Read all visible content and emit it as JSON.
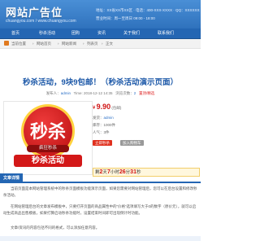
{
  "header": {
    "site_title": "网站广告位",
    "site_url": "chuangyou.com / www.chuangyou.com",
    "info_line1": "地址：XX省XX市XX区 · 电话：400-XXX-XXXX · QQ：XXXXXXX",
    "info_line2": "营业时间：周一至周日 09:00 - 18:00"
  },
  "nav": {
    "items": [
      "首页",
      "秒杀活动",
      "团购",
      "资讯",
      "关于我们",
      "联系我们"
    ]
  },
  "breadcrumb": [
    "当前位置",
    "网站首页",
    "网站新闻",
    "列表页",
    "正文"
  ],
  "article": {
    "title": "秒杀活动，9块9包邮！（秒杀活动演示页面）",
    "meta_author_label": "发布人：",
    "meta_author": "admin",
    "meta_time_label": "Time: 2018-12-12 14:35",
    "meta_views_label": "浏览次数：",
    "meta_views": "2",
    "meta_tag": "置顶/精选"
  },
  "product": {
    "seal_text": "秒杀",
    "tagline": "疯狂秒杀",
    "ribbon_text": "秒杀活动"
  },
  "price_panel": {
    "price_symbol": "¥",
    "price": "9.90",
    "price_note": "(包邮)",
    "seller_label": "发货：",
    "seller": "admin",
    "stock_label": "库存：",
    "stock": "1000件",
    "views_label": "人气：",
    "views": "3件",
    "button_buy": "立即秒杀",
    "button_cart": "加入购物车",
    "countdown_prefix": "剩",
    "countdown_days": "2",
    "countdown_days_unit": "天",
    "countdown_hours": "7",
    "countdown_hours_unit": "小时",
    "countdown_minutes": "26",
    "countdown_minutes_unit": "分",
    "countdown_seconds": "31",
    "countdown_seconds_unit": "秒"
  },
  "section": {
    "heading": "文章详情",
    "paragraphs": [
      "　　当前页面是本网站管理系统中的秒杀页面模板功能演示页面，如果您需要对网站管理后，您可以在后台设置和修改秒杀活动。",
      "　　在网站管理后台的文章发布模板中，只要打开页面的商品属性中的“价格”选项填写大于0的数字（原价元），就可以启动生成商品出售模板，如果打算启动秒杀功能时，设置结束时间即可出现倒计时功能。",
      "　　文章/资讯的内容包括不同的格式，可以添加任意内容。"
    ]
  },
  "colors": {
    "header_blue": "#2f72bd",
    "nav_blue": "#2466b3",
    "title_blue": "#1c58a8",
    "price_red": "#d01414"
  }
}
